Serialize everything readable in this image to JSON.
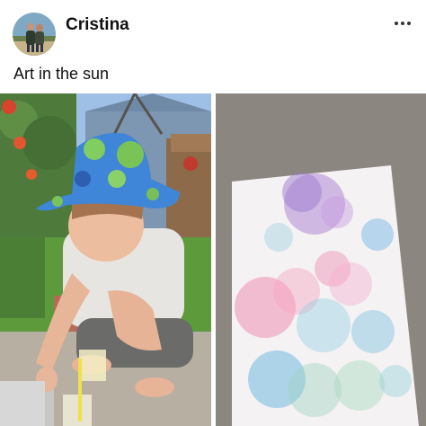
{
  "post": {
    "author_name": "Cristina",
    "caption": "Art in the sun",
    "more_label": "•••"
  },
  "photos": [
    {
      "name": "child-painting-photo"
    },
    {
      "name": "bubble-painting-photo"
    }
  ],
  "colors": {
    "text": "#111111",
    "background": "#ffffff"
  }
}
